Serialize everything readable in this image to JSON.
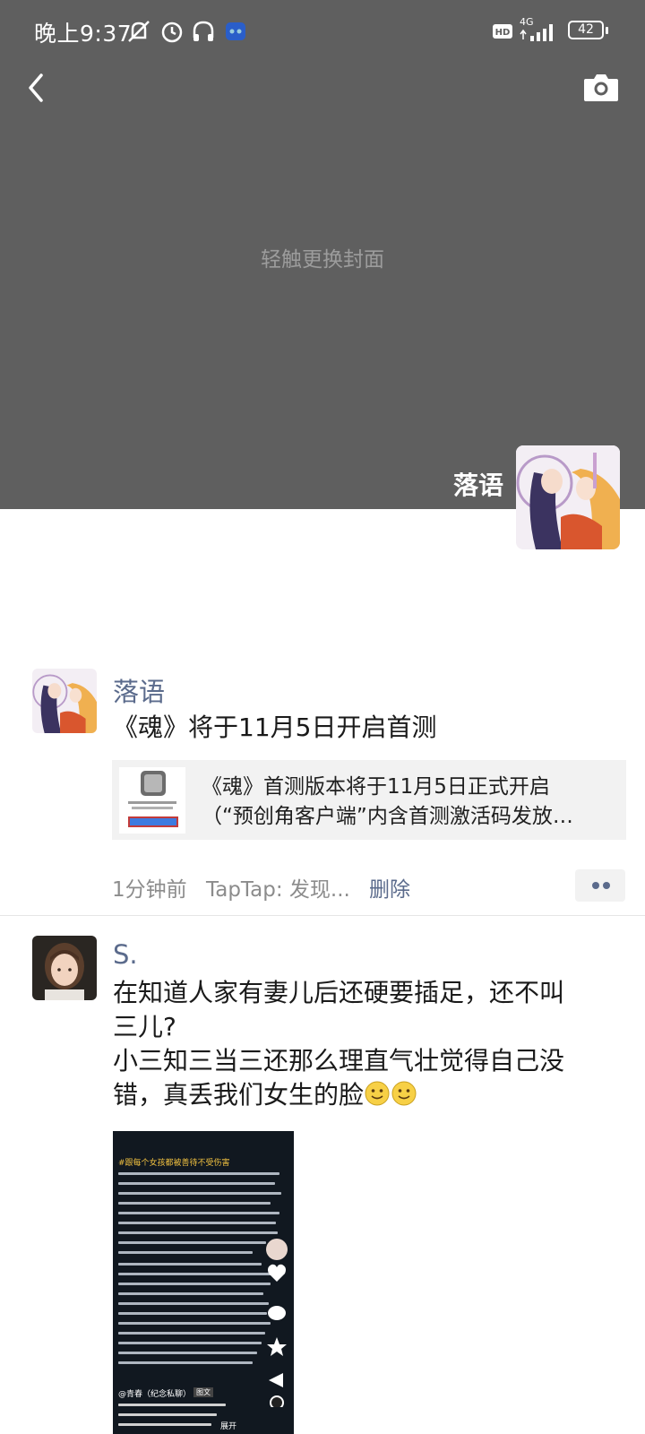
{
  "status_bar": {
    "time": "晚上9:37",
    "icons": [
      "mute-icon",
      "alarm-icon",
      "headphone-icon",
      "app-icon",
      "hd-icon",
      "signal-4g-icon",
      "battery-icon"
    ],
    "network": "4G",
    "battery": "42"
  },
  "cover": {
    "hint": "轻触更换封面",
    "user_name": "落语",
    "background_color": "#5f5f5f"
  },
  "posts": [
    {
      "author": "落语",
      "text": "《魂》将于11月5日开启首测",
      "link": {
        "line1": "《魂》首测版本将于11月5日正式开启",
        "line2": "（“预创角客户端”内含首测激活码发放…"
      },
      "time": "1分钟前",
      "source": "TapTap: 发现...",
      "delete_label": "删除"
    },
    {
      "author": "S.",
      "text_line1": "在知道人家有妻儿后还硬要插足，还不叫",
      "text_line2": "三儿?",
      "text_line3": "小三知三当三还那么理直气壮觉得自己没",
      "text_line4": "错，真丢我们女生的脸",
      "emojis": [
        "smile-emoji-icon",
        "smile-emoji-icon"
      ],
      "video": {
        "header": "#跟每个女孩都被善待不受伤害",
        "footer_author": "@青春（纪念私聊）",
        "footer_tag": "图文",
        "expand": "展开"
      }
    }
  ],
  "colors": {
    "link_blue": "#5b6b8c",
    "meta_gray": "#8c8c8c"
  }
}
